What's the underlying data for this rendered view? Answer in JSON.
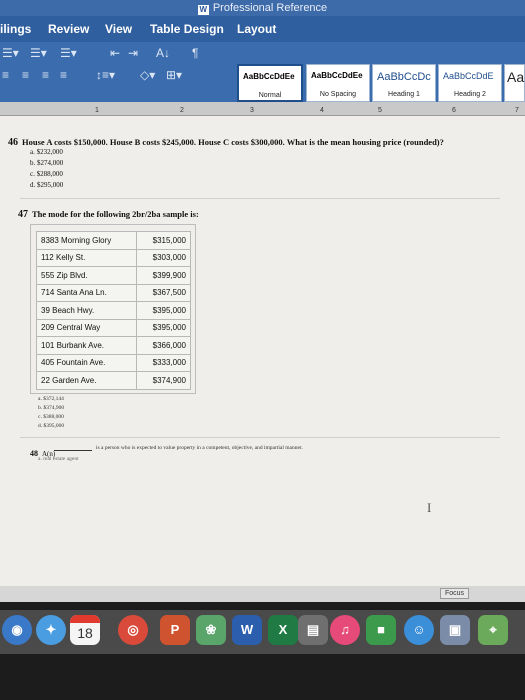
{
  "window": {
    "title": "Professional Reference",
    "app_badge": "W"
  },
  "ribbon": {
    "tabs": [
      "ilings",
      "Review",
      "View",
      "Table Design",
      "Layout"
    ],
    "styles": [
      {
        "sample": "AaBbCcDdEe",
        "name": "Normal",
        "selected": true
      },
      {
        "sample": "AaBbCcDdEe",
        "name": "No Spacing",
        "selected": false
      },
      {
        "sample": "AaBbCcDс",
        "name": "Heading 1",
        "selected": false
      },
      {
        "sample": "AaBbCcDdE",
        "name": "Heading 2",
        "selected": false
      },
      {
        "sample": "Aa",
        "name": "",
        "selected": false
      }
    ],
    "icons": [
      "bullets-icon",
      "numbering-icon",
      "multilevel-list-icon",
      "decrease-indent-icon",
      "increase-indent-icon",
      "sort-icon",
      "pilcrow-icon",
      "align-left-icon",
      "align-center-icon",
      "align-right-icon",
      "line-spacing-icon",
      "shading-icon",
      "borders-icon"
    ]
  },
  "ruler": {
    "ticks": [
      "1",
      "2",
      "3",
      "4",
      "5",
      "6",
      "7"
    ]
  },
  "document": {
    "q46": {
      "number": "46",
      "text": "House A costs $150,000. House B costs $245,000. House C costs $300,000. What is the mean housing price (rounded)?",
      "options": [
        "a. $232,000",
        "b. $274,000",
        "c. $288,000",
        "d. $295,000"
      ]
    },
    "q47": {
      "number": "47",
      "text": "The mode for the following 2br/2ba sample is:",
      "table": [
        {
          "address": "8383 Morning Glory",
          "price": "$315,000"
        },
        {
          "address": "112 Kelly St.",
          "price": "$303,000"
        },
        {
          "address": "555 Zip Blvd.",
          "price": "$399,900"
        },
        {
          "address": "714 Santa Ana Ln.",
          "price": "$367,500"
        },
        {
          "address": "39 Beach Hwy.",
          "price": "$395,000"
        },
        {
          "address": "209 Central Way",
          "price": "$395,000"
        },
        {
          "address": "101 Burbank Ave.",
          "price": "$366,000"
        },
        {
          "address": "405 Fountain Ave.",
          "price": "$333,000"
        },
        {
          "address": "22 Garden Ave.",
          "price": "$374,900"
        }
      ],
      "options": [
        "a. $372,144",
        "b. $374,900",
        "c. $388,000",
        "d. $395,000"
      ]
    },
    "q48": {
      "number": "48",
      "prefix": "A(n)",
      "text": "is a person who is expected to value property in a competent, objective, and impartial manner.",
      "option": "a. real estate agent"
    }
  },
  "status": {
    "focus_label": "Focus"
  },
  "dock": {
    "icons": [
      {
        "name": "launchpad-icon",
        "label": "",
        "color": "#3a78c8"
      },
      {
        "name": "safari-icon",
        "label": "",
        "color": "#4a9de0"
      },
      {
        "name": "calendar-icon",
        "label": "18",
        "color": "#f5f5f5"
      },
      {
        "name": "chrome-icon",
        "label": "",
        "color": "#d94a3a"
      },
      {
        "name": "powerpoint-icon",
        "label": "P",
        "color": "#d0532f"
      },
      {
        "name": "photos-icon",
        "label": "",
        "color": "#5aa56a"
      },
      {
        "name": "word-icon",
        "label": "W",
        "color": "#2b5fae"
      },
      {
        "name": "excel-icon",
        "label": "X",
        "color": "#1f7a44"
      },
      {
        "name": "notes-icon",
        "label": "",
        "color": "#6f6f6f"
      },
      {
        "name": "music-icon",
        "label": "",
        "color": "#e64a78"
      },
      {
        "name": "facetime-icon",
        "label": "",
        "color": "#3b9a4c"
      },
      {
        "name": "finder-icon",
        "label": "",
        "color": "#3a8fd8"
      },
      {
        "name": "preview-icon",
        "label": "",
        "color": "#7a8ca8"
      },
      {
        "name": "maps-icon",
        "label": "",
        "color": "#6aaa5a"
      }
    ]
  }
}
